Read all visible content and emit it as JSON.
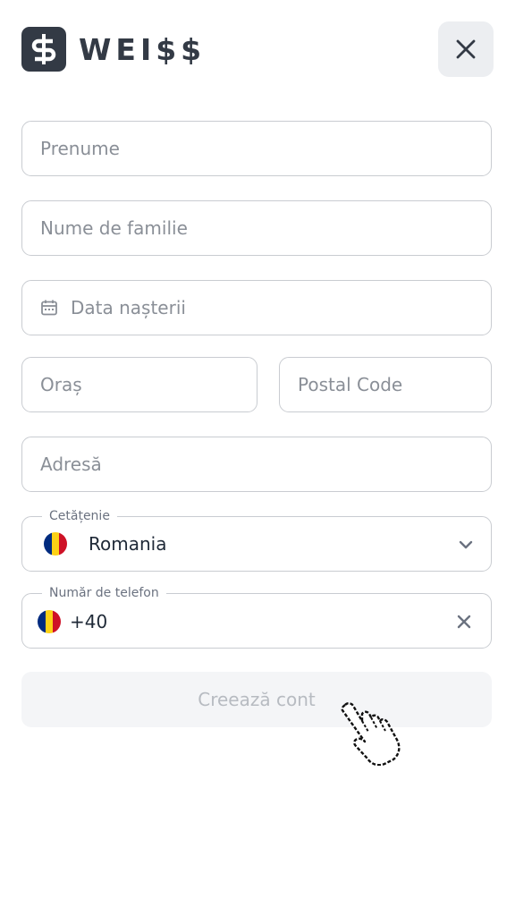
{
  "brand": {
    "name": "WEI$$"
  },
  "form": {
    "first_name": {
      "placeholder": "Prenume"
    },
    "last_name": {
      "placeholder": "Nume de familie"
    },
    "birth_date": {
      "placeholder": "Data nașterii",
      "icon": "calendar-icon"
    },
    "city": {
      "placeholder": "Oraș"
    },
    "postal_code": {
      "placeholder": "Postal Code"
    },
    "address": {
      "placeholder": "Adresă"
    },
    "citizenship": {
      "label": "Cetățenie",
      "value": "Romania",
      "flag": "romania-flag"
    },
    "phone": {
      "label": "Număr de telefon",
      "value": "+40",
      "flag": "romania-flag"
    },
    "submit_label": "Creează cont"
  },
  "colors": {
    "brand": "#333a45",
    "border": "#c9ccd1",
    "placeholder": "#8a8f97",
    "disabled_button_bg": "#f4f5f7",
    "disabled_button_text": "#b7bbc1",
    "flag_blue": "#002b7f",
    "flag_yellow": "#fcd116",
    "flag_red": "#ce1126"
  }
}
